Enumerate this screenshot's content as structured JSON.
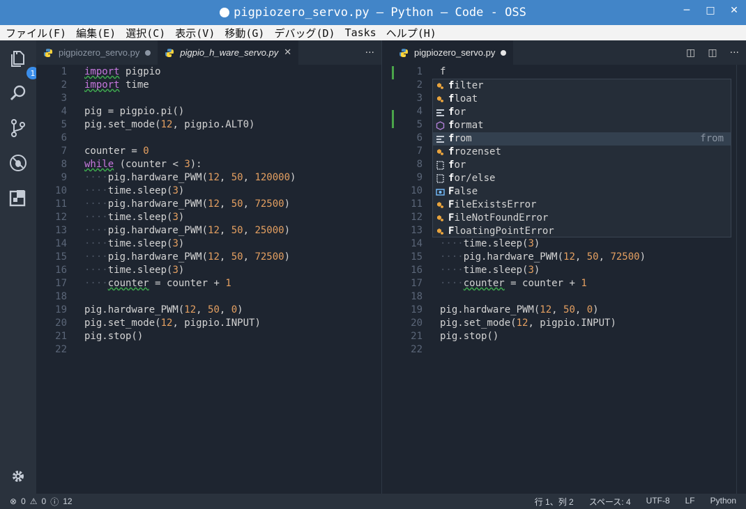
{
  "window": {
    "title": "pigpiozero_servo.py — Python — Code - OSS"
  },
  "menu": [
    "ファイル(F)",
    "編集(E)",
    "選択(C)",
    "表示(V)",
    "移動(G)",
    "デバッグ(D)",
    "Tasks",
    "ヘルプ(H)"
  ],
  "activity": {
    "explorer_badge": "1"
  },
  "left_group": {
    "tabs": [
      {
        "label": "pigpiozero_servo.py",
        "modified": true,
        "active": false
      },
      {
        "label": "pigpio_h_ware_servo.py",
        "active": true
      }
    ],
    "more": "···"
  },
  "right_group": {
    "tabs": [
      {
        "label": "pigpiozero_servo.py",
        "modified": true,
        "active": true
      }
    ],
    "more": "···"
  },
  "left_code": [
    "1",
    "2",
    "3",
    "4",
    "5",
    "6",
    "7",
    "8",
    "9",
    "10",
    "11",
    "12",
    "13",
    "14",
    "15",
    "16",
    "17",
    "18",
    "19",
    "20",
    "21",
    "22"
  ],
  "suggest": {
    "items": [
      {
        "label": "filter",
        "icon": "method-icon"
      },
      {
        "label": "float",
        "icon": "method-icon"
      },
      {
        "label": "for",
        "icon": "keyword-icon"
      },
      {
        "label": "format",
        "icon": "cube-icon"
      },
      {
        "label": "from",
        "icon": "keyword-icon",
        "detail": "from",
        "selected": true
      },
      {
        "label": "frozenset",
        "icon": "method-icon"
      },
      {
        "label": "for",
        "icon": "snippet-icon"
      },
      {
        "label": "for/else",
        "icon": "snippet-icon"
      },
      {
        "label": "False",
        "icon": "enum-icon"
      },
      {
        "label": "FileExistsError",
        "icon": "method-icon"
      },
      {
        "label": "FileNotFoundError",
        "icon": "method-icon"
      },
      {
        "label": "FloatingPointError",
        "icon": "method-icon"
      }
    ]
  },
  "status": {
    "errors": "0",
    "warnings": "0",
    "infos": "12",
    "position": "行 1、列 2",
    "spaces": "スペース: 4",
    "encoding": "UTF-8",
    "eol": "LF",
    "language": "Python"
  }
}
